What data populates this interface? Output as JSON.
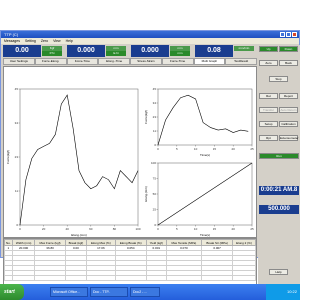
{
  "window": {
    "title": "TTP (C)",
    "menu": [
      "Messages",
      "Setting",
      "Zero",
      "View",
      "Help"
    ]
  },
  "readouts": [
    {
      "value": "0.00",
      "label1": "Kgf",
      "label2": "P.hi"
    },
    {
      "value": "0.000",
      "label1": "mm",
      "label2": "E.hi"
    },
    {
      "value": "0.000",
      "label1": "mm",
      "label2": "mm"
    },
    {
      "value": "0.08",
      "label1": "mm/min",
      "label2": ""
    }
  ],
  "tabs": [
    "User Settings",
    "Force-Elong.",
    "Force-Time",
    "Elong.-Time",
    "Stress-Strain",
    "Force-Time",
    "Multi Graph",
    "TestResult"
  ],
  "active_tab": "Multi Graph",
  "right_panel": {
    "buttons": [
      "Up",
      "Down",
      "Zero",
      "Back",
      "Stop",
      "Ret",
      "Report",
      "Transfer",
      "Auto Return",
      "Setup",
      "Calibration",
      "Rpt",
      "Extensometer",
      "Help"
    ],
    "clock": "0:00:21 AM.8",
    "speed": "500.000",
    "status": "Run"
  },
  "grid": {
    "headers": [
      "No.",
      "Width (mm)",
      "Max Force (kgf)",
      "Break (kgf)",
      "Elong Max (%)",
      "Elong Break (%)",
      "Yield (kgf)",
      "Max Tensile (MPa)",
      "Break Str (MPa)",
      "Elong 2 (%)"
    ],
    "rows": [
      [
        "1",
        "20.000",
        "36.80",
        "0.00",
        "17.06",
        "0.054",
        "0.001",
        "0.070",
        "0.007",
        ""
      ]
    ]
  },
  "taskbar": {
    "start": "start",
    "tasks": [
      "Microsoft Office...",
      "Doc - TTP..",
      "Doc2 - ..."
    ],
    "time": "10:22"
  },
  "chart_data": [
    {
      "type": "line",
      "xlabel": "Elong.(mm)",
      "ylabel": "Force(kgf)",
      "xlim": [
        0,
        100
      ],
      "ylim": [
        0,
        45
      ],
      "x": [
        0,
        5,
        10,
        15,
        20,
        25,
        30,
        35,
        40,
        45,
        50,
        55,
        60,
        65,
        70,
        75,
        80,
        85,
        90,
        95,
        100
      ],
      "y": [
        0,
        15,
        22,
        25,
        26,
        27,
        30,
        40,
        43,
        32,
        18,
        14,
        12,
        13,
        16,
        15,
        12,
        18,
        16,
        14,
        18
      ]
    },
    {
      "type": "line",
      "xlabel": "Time(s)",
      "ylabel": "Force(kgf)",
      "xlim": [
        0,
        25
      ],
      "ylim": [
        0,
        45
      ],
      "x": [
        0,
        2,
        4,
        6,
        8,
        10,
        12,
        14,
        16,
        18,
        20,
        22,
        24
      ],
      "y": [
        0,
        20,
        30,
        38,
        40,
        37,
        18,
        14,
        12,
        13,
        10,
        12,
        11
      ]
    },
    {
      "type": "line",
      "xlabel": "Time(s)",
      "ylabel": "Elong.(mm)",
      "xlim": [
        0,
        25
      ],
      "ylim": [
        0,
        100
      ],
      "x": [
        0,
        25
      ],
      "y": [
        0,
        100
      ]
    }
  ]
}
